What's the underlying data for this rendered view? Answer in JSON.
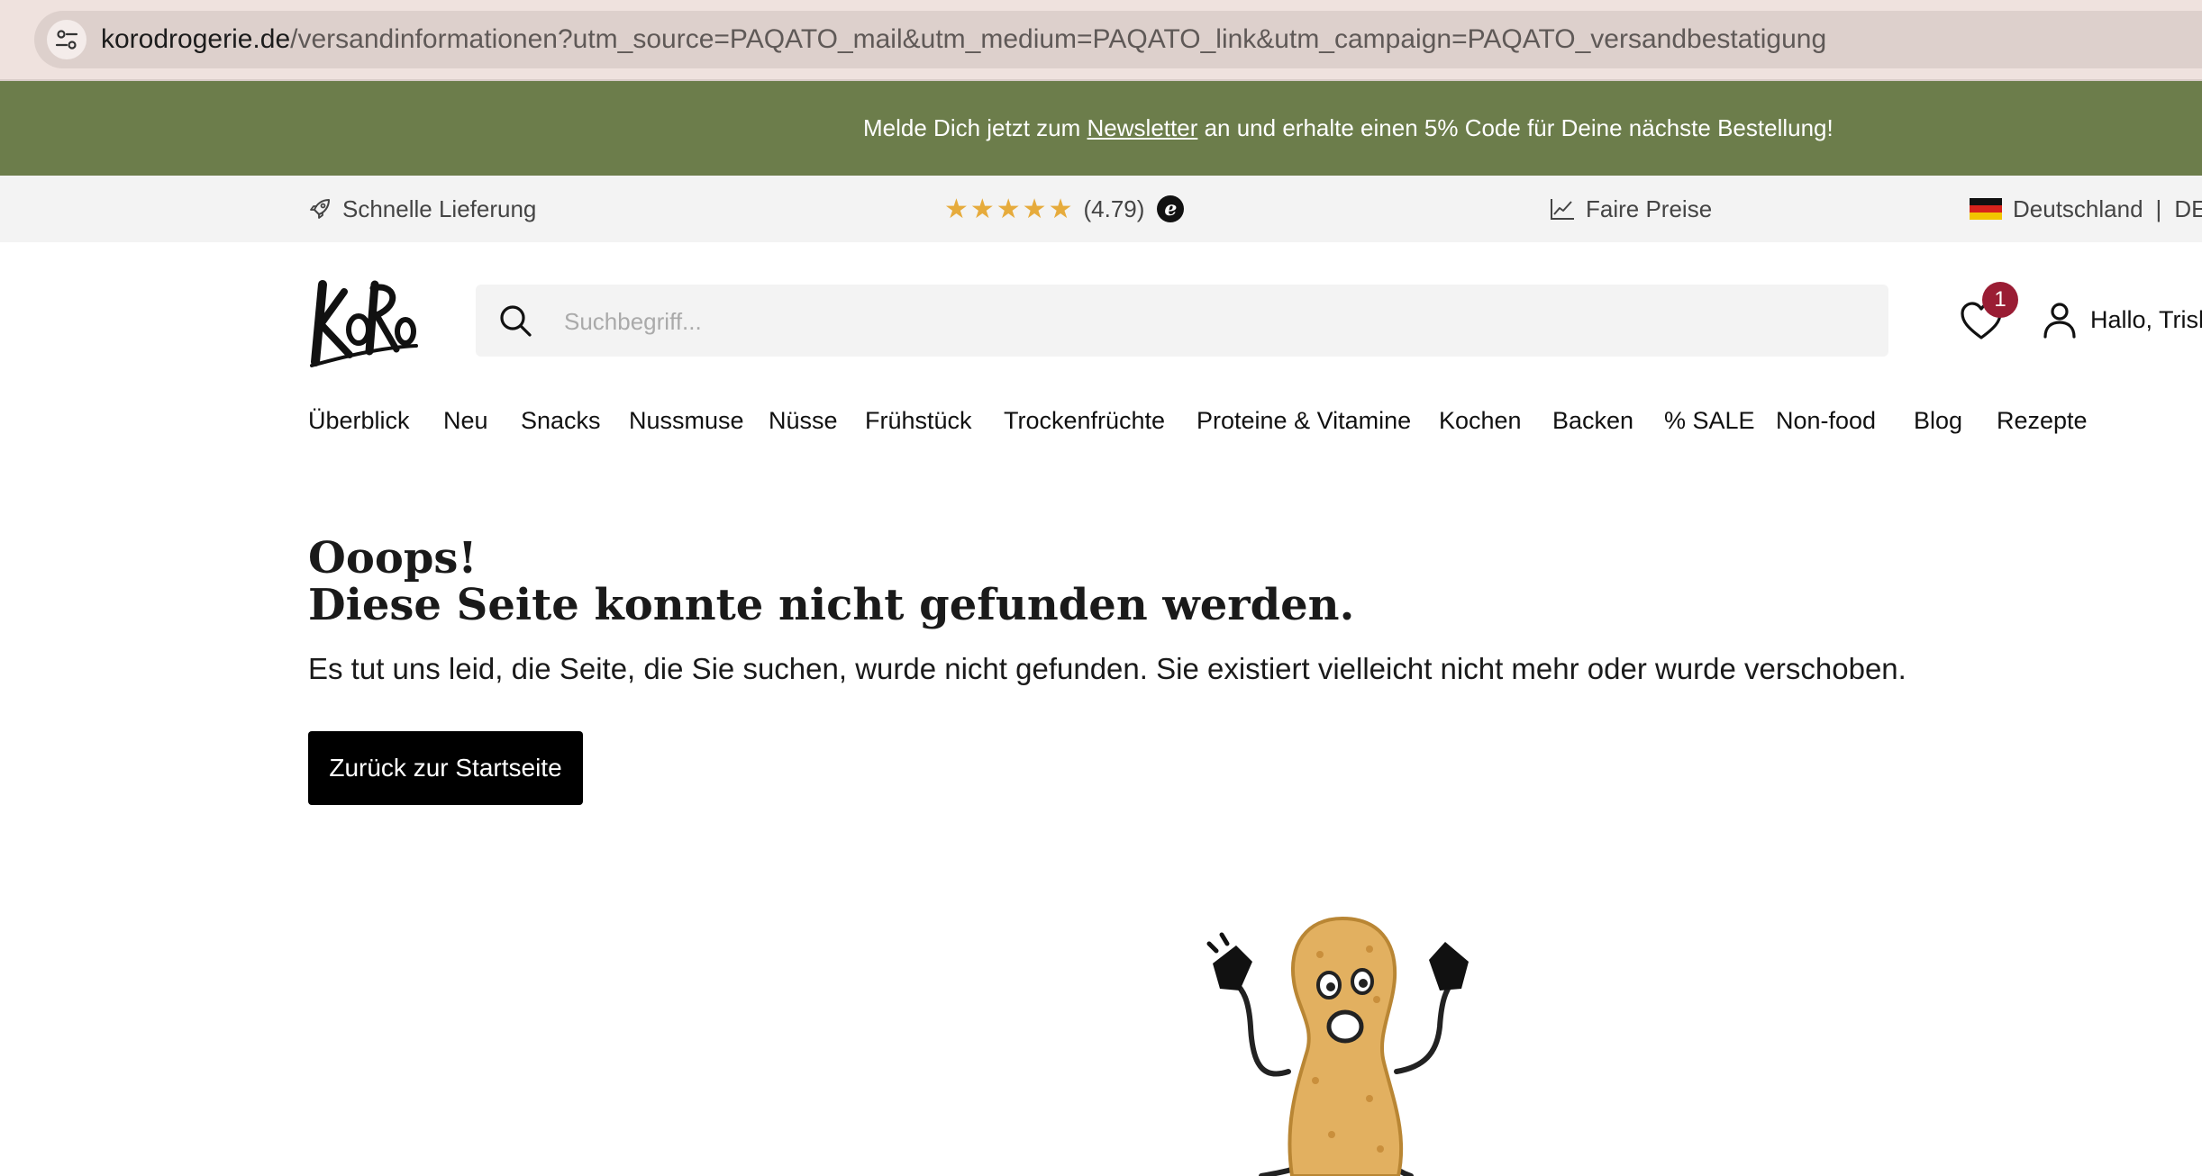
{
  "browser": {
    "url_host": "korodrogerie.de",
    "url_path": "/versandinformationen?utm_source=PAQATO_mail&utm_medium=PAQATO_link&utm_campaign=PAQATO_versandbestatigung",
    "site_info_icon": "tune-icon"
  },
  "promo": {
    "text_before": "Melde Dich jetzt zum ",
    "link": "Newsletter",
    "text_after": " an und erhalte einen 5% Code für Deine nächste Bestellung!",
    "background": "#6c7d4b"
  },
  "usp": {
    "delivery": "Schnelle Lieferung",
    "stars": "★★★★★",
    "rating": "(4.79)",
    "trust_badge": "e",
    "prices": "Faire Preise",
    "country": "Deutschland",
    "separator": "|",
    "language": "DE"
  },
  "header": {
    "search_placeholder": "Suchbegriff...",
    "wishlist_count": "1",
    "account_label": "Hallo, Trish"
  },
  "nav": [
    "Überblick",
    "Neu",
    "Snacks",
    "Nussmuse",
    "Nüsse",
    "Frühstück",
    "Trockenfrüchte",
    "Proteine & Vitamine",
    "Kochen",
    "Backen",
    "% SALE",
    "Non-food",
    "Blog",
    "Rezepte"
  ],
  "error": {
    "title_line1": "Ooops!",
    "title_line2": "Diese Seite konnte nicht gefunden werden.",
    "text": "Es tut uns leid, die Seite, die Sie suchen, wurde nicht gefunden. Sie existiert vielleicht nicht mehr oder wurde verschoben.",
    "button": "Zurück zur Startseite"
  },
  "colors": {
    "accent": "#6c7d4b",
    "badge": "#9a1d34",
    "stars": "#e6ab3c",
    "button": "#000000"
  }
}
